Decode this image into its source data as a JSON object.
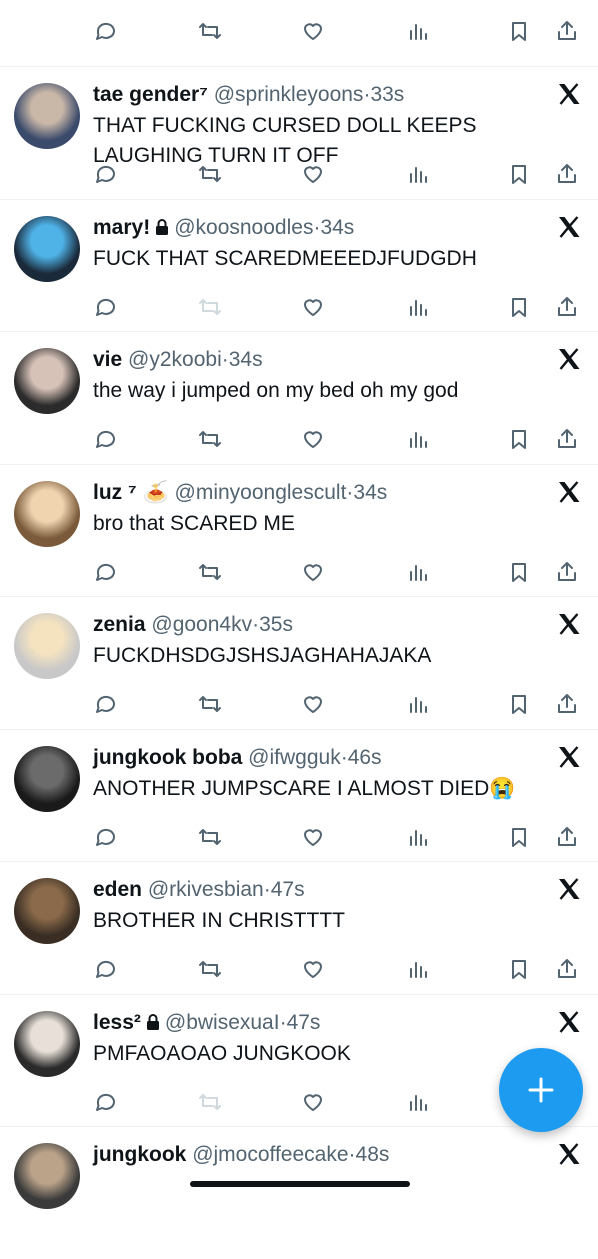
{
  "tweets": [
    {
      "name": "tae gender⁷",
      "handle": "@sprinkleyoons",
      "time": "33s",
      "lock": false,
      "text": "THAT FUCKING CURSED DOLL KEEPS LAUGHING TURN IT OFF",
      "retweet_disabled": false
    },
    {
      "name": "mary!",
      "handle": "@koosnoodles",
      "time": "34s",
      "lock": true,
      "text": "FUCK THAT SCAREDMEEEDJFUDGDH",
      "retweet_disabled": true
    },
    {
      "name": "vie",
      "handle": "@y2koobi",
      "time": "34s",
      "lock": false,
      "text": "the way i jumped on my bed oh my god",
      "retweet_disabled": false
    },
    {
      "name": "luz ⁷",
      "handle": "@minyoonglescult",
      "time": "34s",
      "lock": false,
      "emoji": "🍝",
      "text": "bro that SCARED ME",
      "retweet_disabled": false
    },
    {
      "name": "zenia",
      "handle": "@goon4kv",
      "time": "35s",
      "lock": false,
      "text": "FUCKDHSDGJSHSJAGHAHAJAKA",
      "retweet_disabled": false
    },
    {
      "name": "jungkook boba",
      "handle": "@ifwgguk",
      "time": "46s",
      "lock": false,
      "text": "ANOTHER JUMPSCARE I ALMOST DIED",
      "text_emoji": "😭",
      "retweet_disabled": false
    },
    {
      "name": "eden",
      "handle": "@rkivesbian",
      "time": "47s",
      "lock": false,
      "text": "BROTHER IN CHRISTTTT",
      "retweet_disabled": false
    },
    {
      "name": "less²",
      "handle": "@bwisexuaI",
      "time": "47s",
      "lock": true,
      "text": "PMFAOAOAO JUNGKOOK",
      "retweet_disabled": true
    },
    {
      "name": "jungkook",
      "handle": "@jmocoffeecake",
      "time": "48s",
      "lock": false,
      "text": "",
      "retweet_disabled": false
    }
  ],
  "separator": "·",
  "icons": {
    "reply": "reply-icon",
    "retweet": "retweet-icon",
    "like": "like-icon",
    "views": "views-icon",
    "bookmark": "bookmark-icon",
    "share": "share-icon",
    "platform": "x-logo-icon",
    "compose": "plus-icon"
  },
  "colors": {
    "accent": "#1d9bf0",
    "muted": "#536471",
    "text": "#0f1419",
    "border": "#eff3f4"
  }
}
